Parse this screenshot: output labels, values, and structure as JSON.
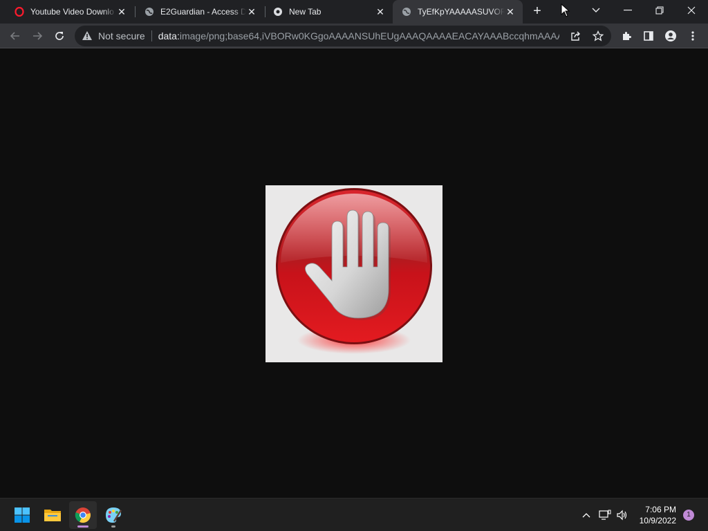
{
  "tabs": [
    {
      "title": "Youtube Video Downlo",
      "icon": "opera-icon"
    },
    {
      "title": "E2Guardian - Access De",
      "icon": "globe-icon"
    },
    {
      "title": "New Tab",
      "icon": "chrome-icon"
    },
    {
      "title": "TyEfKpYAAAAASUVORK",
      "icon": "globe-icon",
      "active": true
    }
  ],
  "toolbar": {
    "security_label": "Not secure",
    "url_scheme": "data:",
    "url_rest": "image/png;base64,iVBORw0KGgoAAAANSUhEUgAAAQAAAAEACAYAAABccqhmAAAAB..."
  },
  "content": {
    "image": "stop-hand-icon",
    "colors": {
      "red": "#c8121a",
      "background": "#0e0e0e",
      "image_bg": "#e9e8e8"
    }
  },
  "taskbar": {
    "apps": [
      "start-icon",
      "file-explorer-icon",
      "chrome-icon",
      "paint-icon"
    ],
    "time": "7:06 PM",
    "date": "10/9/2022",
    "notification_count": "1"
  }
}
